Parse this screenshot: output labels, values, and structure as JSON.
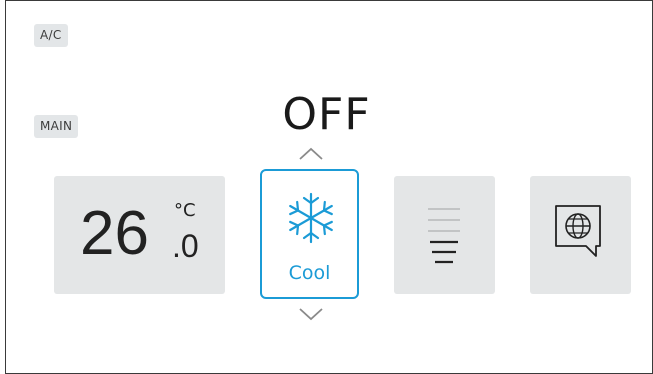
{
  "tags": {
    "ac": "A/C",
    "main": "MAIN"
  },
  "power_status": "OFF",
  "temperature": {
    "integer": "26",
    "decimal": ".0",
    "unit": "°C"
  },
  "mode": {
    "label": "Cool",
    "icon": "snowflake-icon",
    "accent": "#1b9bd6"
  },
  "fan": {
    "icon": "fan-speed-icon",
    "level_bars": 2,
    "total_bars": 5
  },
  "language": {
    "icon": "globe-icon"
  },
  "colors": {
    "tile_bg": "#e4e6e7",
    "tag_bg": "#e3e6e8",
    "accent": "#1b9bd6"
  }
}
